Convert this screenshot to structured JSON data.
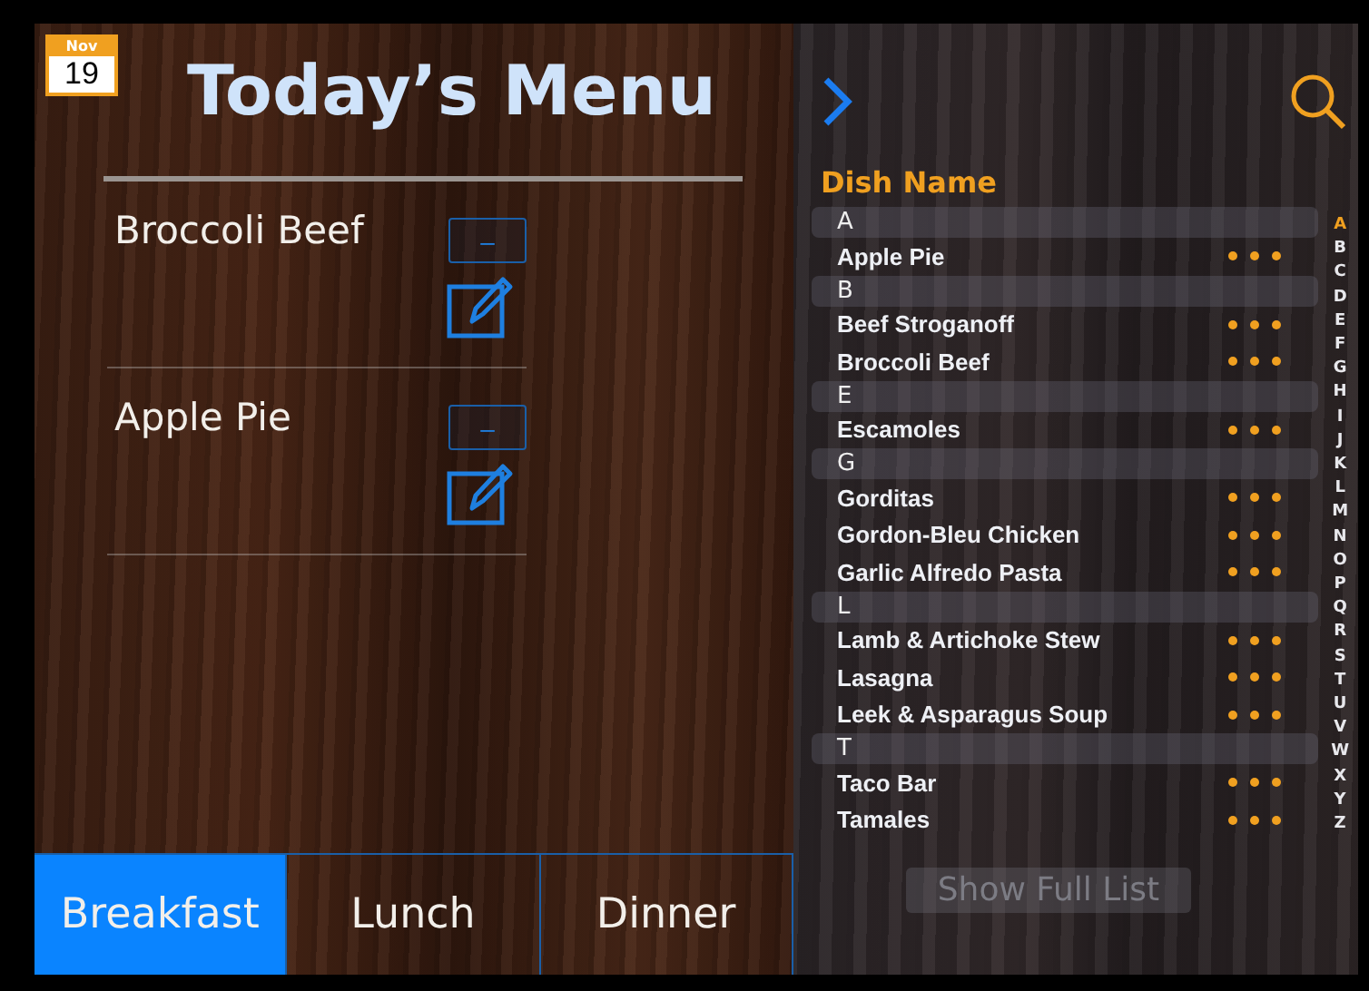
{
  "date_badge": {
    "month": "Nov",
    "day": "19"
  },
  "title": "Today’s Menu",
  "menu_items": [
    {
      "name": "Broccoli Beef",
      "remove_label": "–"
    },
    {
      "name": "Apple Pie",
      "remove_label": "–"
    }
  ],
  "meal_tabs": [
    {
      "label": "Breakfast",
      "selected": true
    },
    {
      "label": "Lunch",
      "selected": false
    },
    {
      "label": "Dinner",
      "selected": false
    }
  ],
  "dish_list": {
    "heading": "Dish Name",
    "sections": [
      {
        "letter": "A",
        "dishes": [
          "Apple Pie"
        ]
      },
      {
        "letter": "B",
        "dishes": [
          "Beef Stroganoff",
          "Broccoli Beef"
        ]
      },
      {
        "letter": "E",
        "dishes": [
          "Escamoles"
        ]
      },
      {
        "letter": "G",
        "dishes": [
          "Gorditas",
          "Gordon-Bleu Chicken",
          "Garlic Alfredo Pasta"
        ]
      },
      {
        "letter": "L",
        "dishes": [
          "Lamb & Artichoke Stew",
          "Lasagna",
          "Leek & Asparagus Soup"
        ]
      },
      {
        "letter": "T",
        "dishes": [
          "Taco Bar",
          "Tamales"
        ]
      }
    ],
    "index": [
      {
        "letter": "A",
        "selected": true
      },
      {
        "letter": "B",
        "selected": false
      },
      {
        "letter": "C",
        "selected": false
      },
      {
        "letter": "D",
        "selected": false
      },
      {
        "letter": "E",
        "selected": false
      },
      {
        "letter": "F",
        "selected": false
      },
      {
        "letter": "G",
        "selected": false
      },
      {
        "letter": "H",
        "selected": false
      },
      {
        "letter": "I",
        "selected": false
      },
      {
        "letter": "J",
        "selected": false
      },
      {
        "letter": "K",
        "selected": false
      },
      {
        "letter": "L",
        "selected": false
      },
      {
        "letter": "M",
        "selected": false
      },
      {
        "letter": "N",
        "selected": false
      },
      {
        "letter": "O",
        "selected": false
      },
      {
        "letter": "P",
        "selected": false
      },
      {
        "letter": "Q",
        "selected": false
      },
      {
        "letter": "R",
        "selected": false
      },
      {
        "letter": "S",
        "selected": false
      },
      {
        "letter": "T",
        "selected": false
      },
      {
        "letter": "U",
        "selected": false
      },
      {
        "letter": "V",
        "selected": false
      },
      {
        "letter": "W",
        "selected": false
      },
      {
        "letter": "X",
        "selected": false
      },
      {
        "letter": "Y",
        "selected": false
      },
      {
        "letter": "Z",
        "selected": false
      }
    ],
    "show_full_list": {
      "label": "Show Full List",
      "disabled": true
    }
  }
}
